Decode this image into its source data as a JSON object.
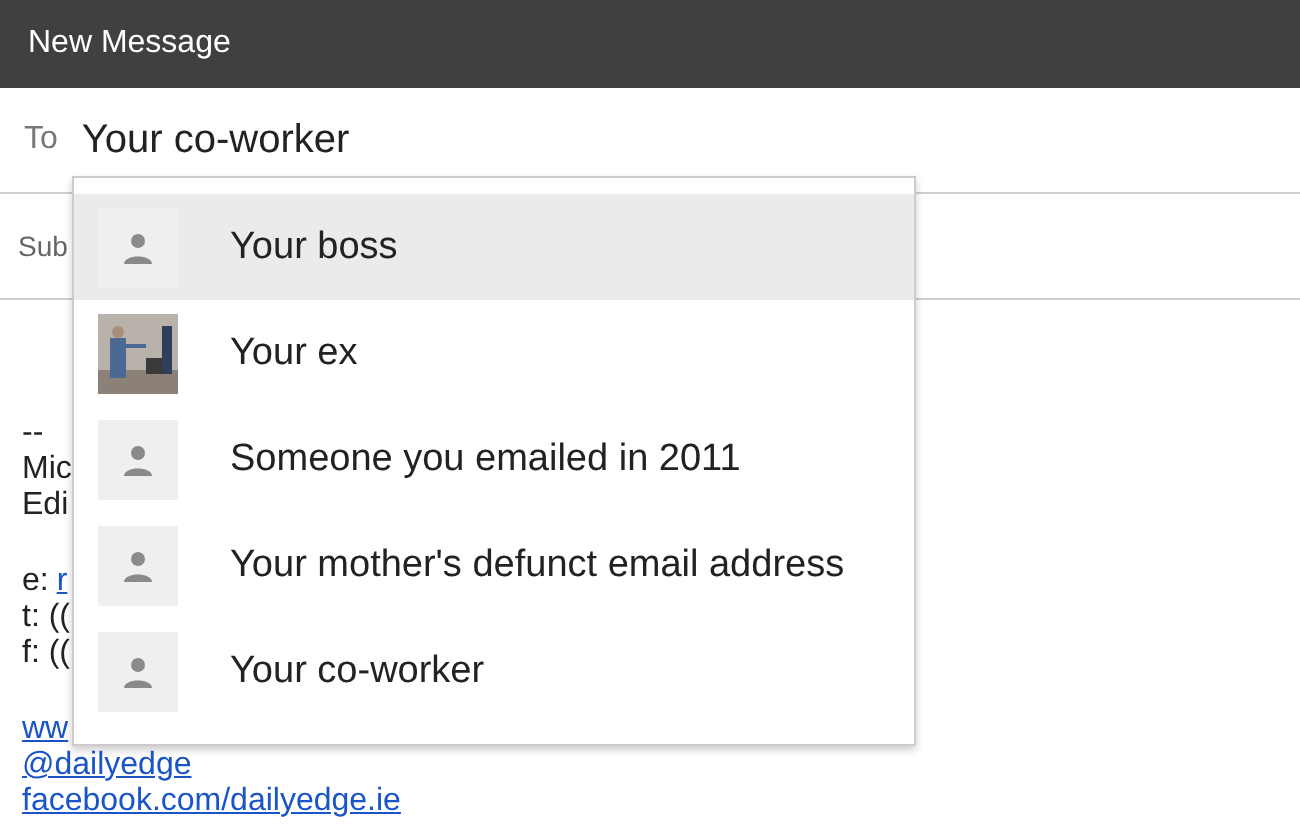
{
  "window": {
    "title": "New Message"
  },
  "to": {
    "label": "To",
    "value": "Your co-worker"
  },
  "subject": {
    "label": "Sub"
  },
  "body": [
    {
      "kind": "text",
      "text": "--"
    },
    {
      "kind": "text",
      "text": "Mic"
    },
    {
      "kind": "text",
      "text": "Edi"
    },
    {
      "kind": "gap"
    },
    {
      "kind": "contact",
      "label": "e:",
      "link": "r"
    },
    {
      "kind": "text",
      "text": "t: (("
    },
    {
      "kind": "text",
      "text": "f: (("
    },
    {
      "kind": "gap"
    },
    {
      "kind": "link",
      "text": "ww"
    },
    {
      "kind": "link",
      "text": "@dailyedge"
    },
    {
      "kind": "link",
      "text": "facebook.com/dailyedge.ie"
    }
  ],
  "suggestions": [
    {
      "name": "Your boss",
      "kind": "default",
      "selected": true
    },
    {
      "name": "Your ex",
      "selected": false
    },
    {
      "name": "Someone you emailed in 2011",
      "kind": "default",
      "selected": false
    },
    {
      "name": "Your mother's defunct email address",
      "kind": "default",
      "selected": false
    },
    {
      "name": "Your co-worker",
      "kind": "default",
      "selected": false
    }
  ]
}
